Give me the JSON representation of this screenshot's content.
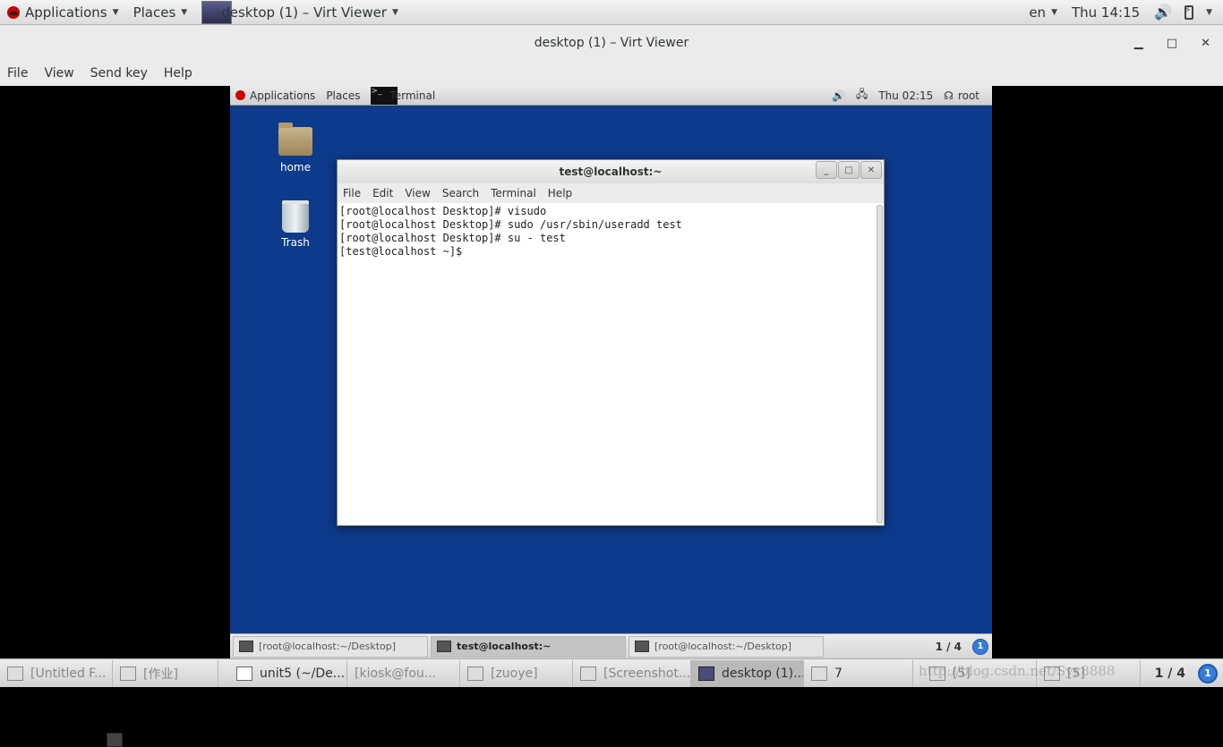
{
  "host_panel": {
    "applications": "Applications",
    "places": "Places",
    "window_title": "desktop (1) – Virt Viewer",
    "language": "en",
    "clock": "Thu 14:15"
  },
  "viewer": {
    "title": "desktop (1) – Virt Viewer",
    "menu": [
      "File",
      "View",
      "Send key",
      "Help"
    ]
  },
  "guest": {
    "panel": {
      "applications": "Applications",
      "places": "Places",
      "active_app": "Terminal",
      "clock": "Thu 02:15",
      "user": "root"
    },
    "desktop_icons": [
      "home",
      "Trash"
    ],
    "terminal": {
      "title": "test@localhost:~",
      "menu": [
        "File",
        "Edit",
        "View",
        "Search",
        "Terminal",
        "Help"
      ],
      "lines": [
        "[root@localhost Desktop]# visudo",
        "[root@localhost Desktop]# sudo /usr/sbin/useradd test",
        "[root@localhost Desktop]# su - test",
        "[test@localhost ~]$ "
      ]
    },
    "taskbar": {
      "tasks": [
        "[root@localhost:~/Desktop]",
        "test@localhost:~",
        "[root@localhost:~/Desktop]"
      ],
      "pager": "1 / 4",
      "notification_count": "1"
    }
  },
  "host_taskbar": {
    "tasks": [
      "[Untitled F...",
      "[作业]",
      "unit5 (~/De...",
      "[kiosk@fou...",
      "[zuoye]",
      "[Screenshot...",
      "desktop (1)...",
      "7",
      "[5]",
      "[5]"
    ],
    "pager": "1 / 4",
    "notification_count": "1",
    "watermark": "http://blog.csdn.net/Syx8888"
  }
}
